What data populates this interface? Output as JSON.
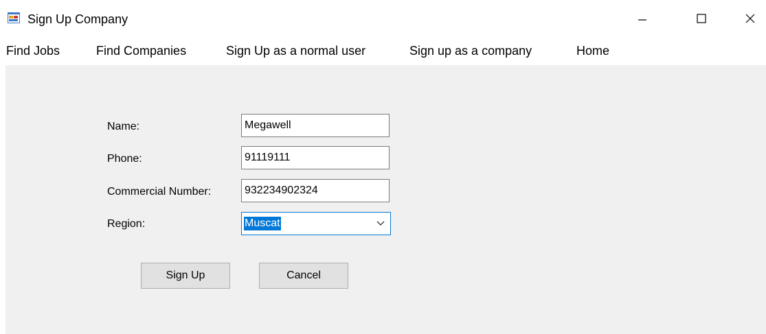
{
  "window": {
    "title": "Sign Up Company",
    "icon": "windows-form-icon",
    "controls": [
      "minimize-icon",
      "maximize-icon",
      "close-icon"
    ]
  },
  "menu": {
    "items": [
      {
        "label": "Find Jobs"
      },
      {
        "label": "Find Companies"
      },
      {
        "label": "Sign Up as a normal user"
      },
      {
        "label": "Sign up as a company"
      },
      {
        "label": "Home"
      }
    ]
  },
  "form": {
    "name_label": "Name:",
    "name_value": "Megawell",
    "phone_label": "Phone:",
    "phone_value": "91119111",
    "commercial_label": "Commercial Number:",
    "commercial_value": "932234902324",
    "region_label": "Region:",
    "region_value": "Muscat",
    "signup_label": "Sign Up",
    "cancel_label": "Cancel"
  },
  "colors": {
    "client_bg": "#f0f0f0",
    "selection": "#0078d7",
    "button_bg": "#e1e1e1"
  }
}
